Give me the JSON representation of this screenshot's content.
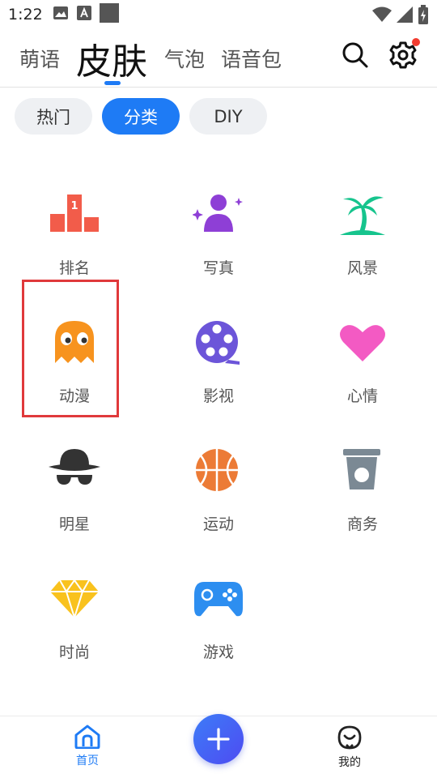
{
  "status_bar": {
    "time": "1:22",
    "icons": [
      "image-icon",
      "font-a-icon",
      "square-icon",
      "wifi-icon",
      "signal-icon",
      "battery-icon"
    ]
  },
  "top_tabs": [
    {
      "label": "萌语",
      "active": false
    },
    {
      "label": "皮肤",
      "active": true
    },
    {
      "label": "气泡",
      "active": false
    },
    {
      "label": "语音包",
      "active": false
    }
  ],
  "chips": [
    {
      "label": "热门",
      "active": false
    },
    {
      "label": "分类",
      "active": true
    },
    {
      "label": "DIY",
      "active": false
    }
  ],
  "categories": [
    {
      "label": "排名",
      "icon": "podium-icon"
    },
    {
      "label": "写真",
      "icon": "person-sparkle-icon"
    },
    {
      "label": "风景",
      "icon": "palm-tree-icon"
    },
    {
      "label": "动漫",
      "icon": "ghost-icon",
      "highlighted": true
    },
    {
      "label": "影视",
      "icon": "film-reel-icon"
    },
    {
      "label": "心情",
      "icon": "heart-icon"
    },
    {
      "label": "明星",
      "icon": "hat-sunglasses-icon"
    },
    {
      "label": "运动",
      "icon": "basketball-icon"
    },
    {
      "label": "商务",
      "icon": "coffee-cup-icon"
    },
    {
      "label": "时尚",
      "icon": "diamond-icon"
    },
    {
      "label": "游戏",
      "icon": "gamepad-icon"
    }
  ],
  "bottom_nav": {
    "home_label": "首页",
    "mine_label": "我的"
  },
  "colors": {
    "accent": "#1e7bf5",
    "highlight_border": "#e0393b",
    "notification_dot": "#f23b2f"
  }
}
